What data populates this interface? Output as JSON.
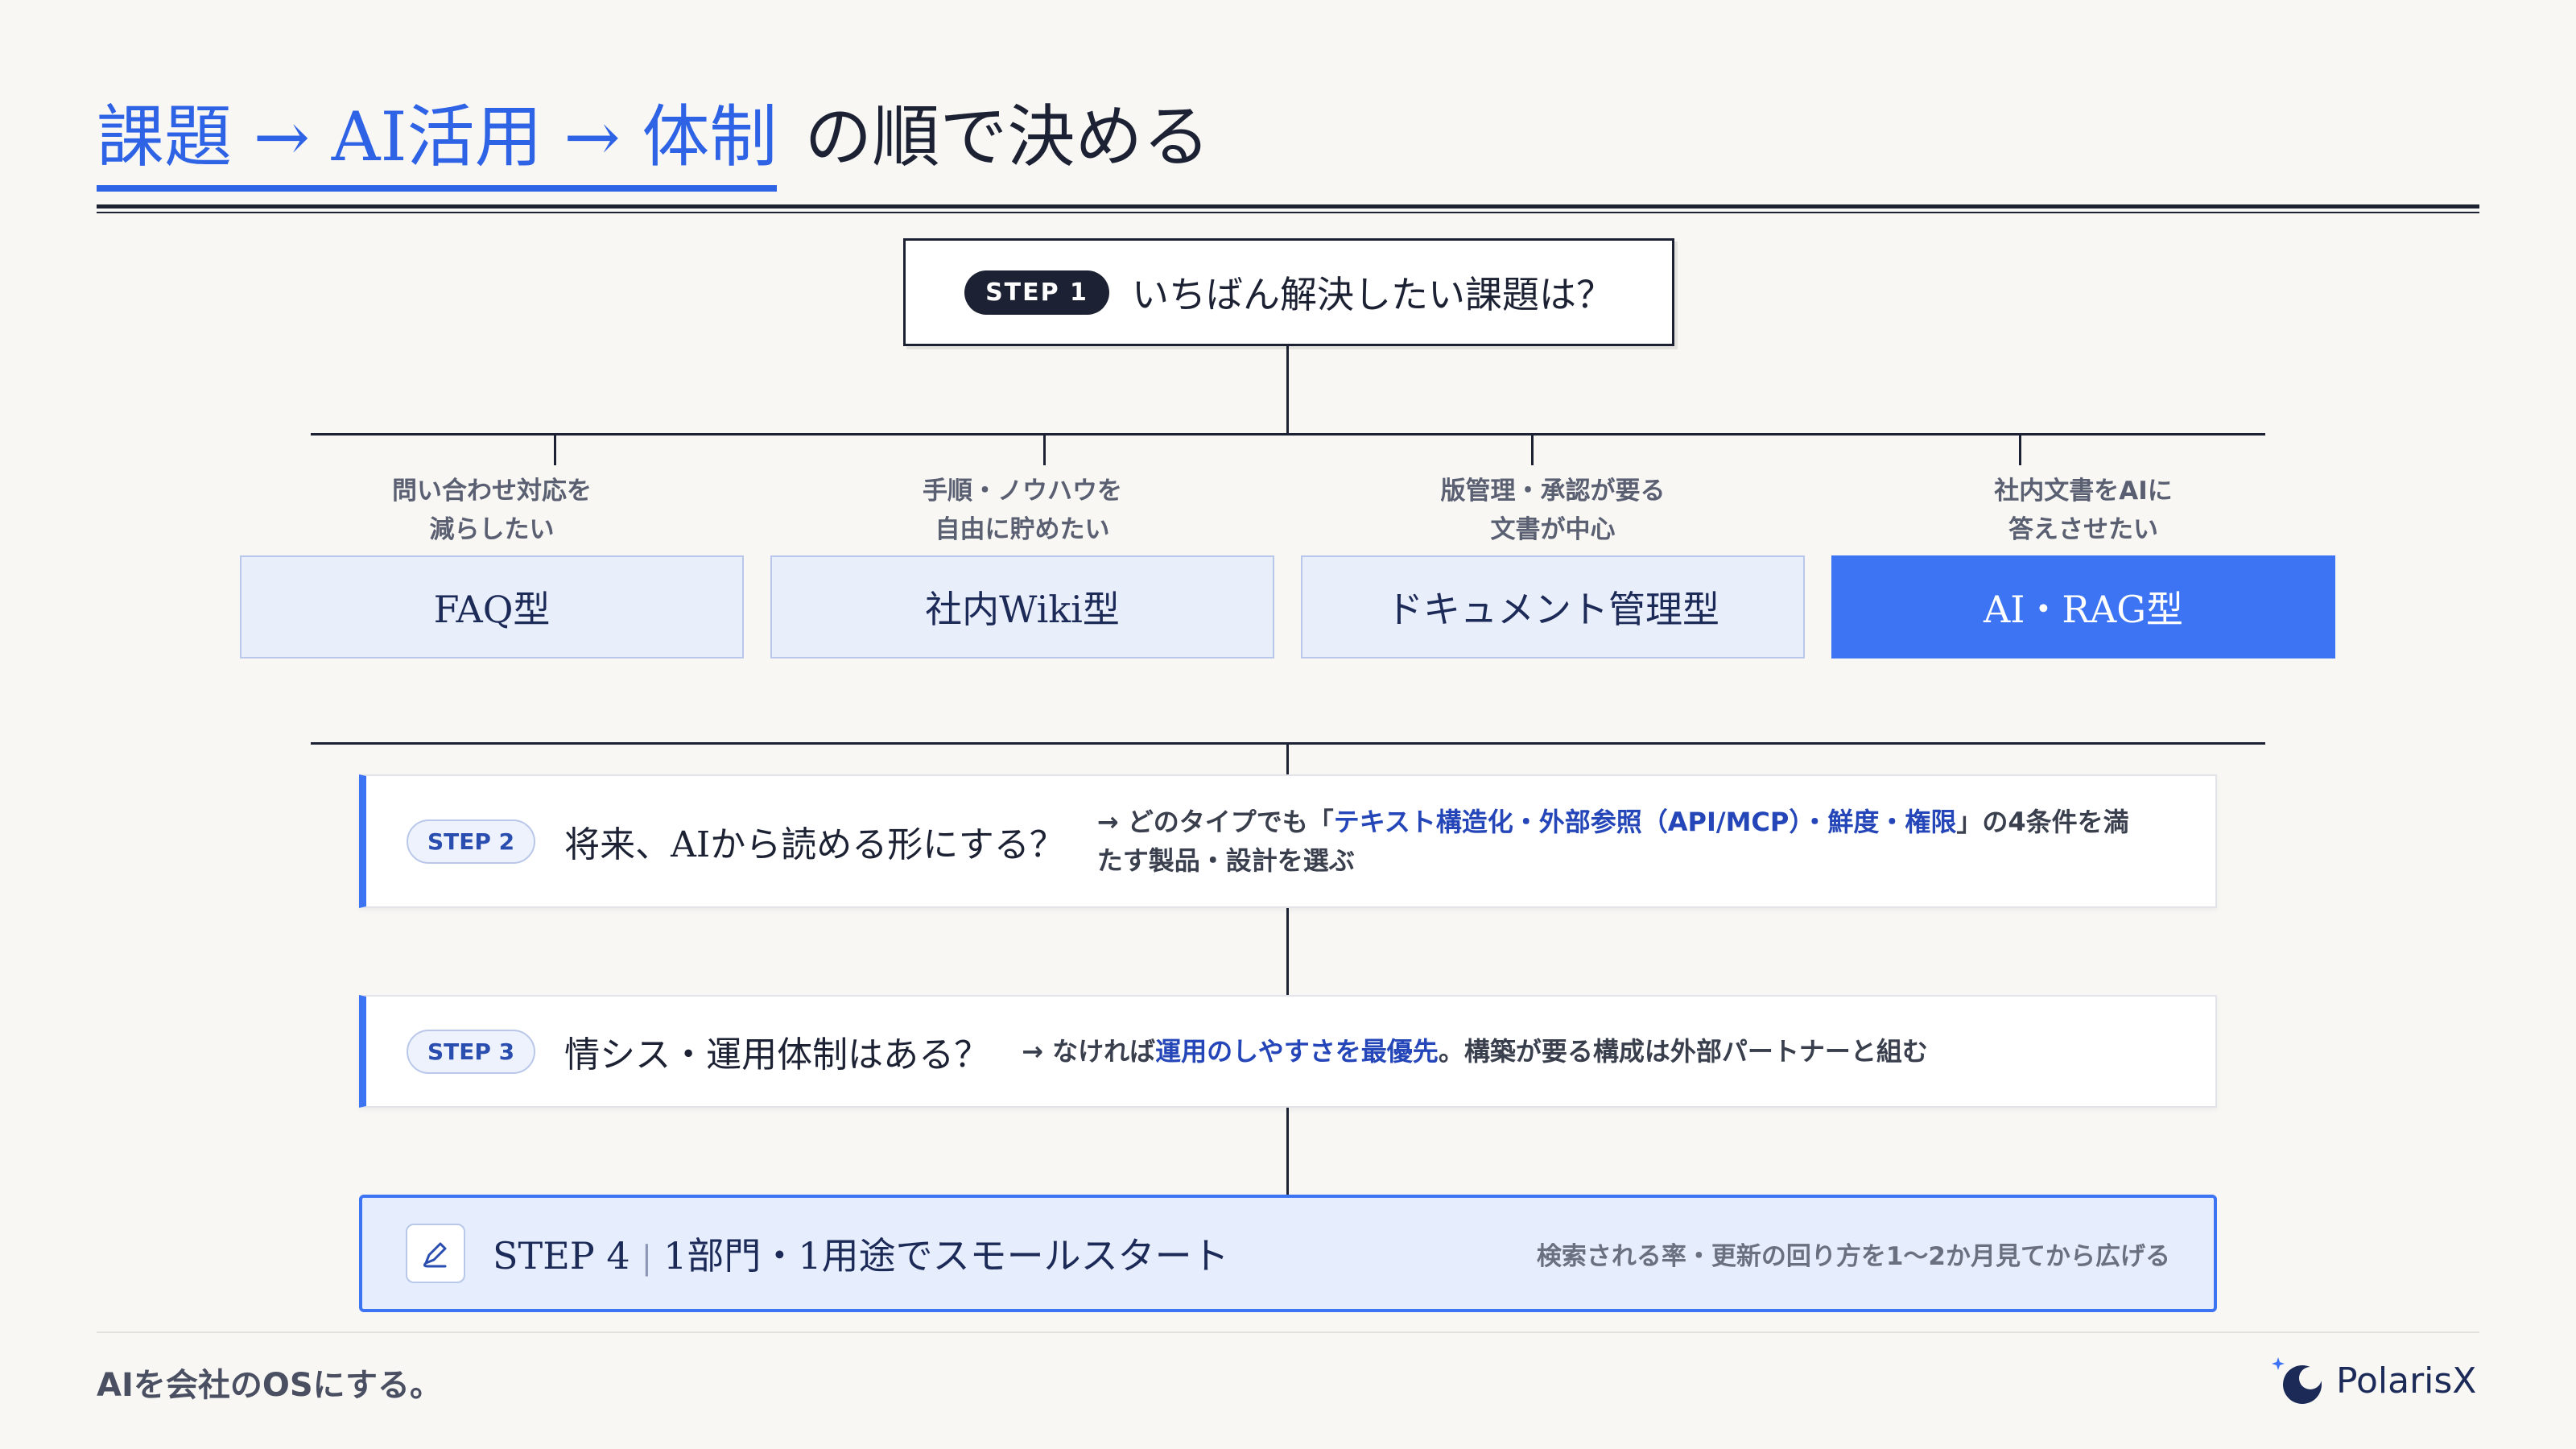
{
  "title": {
    "highlight": "課題 → AI活用 → 体制",
    "rest": "の順で決める"
  },
  "step1": {
    "badge": "STEP 1",
    "question": "いちばん解決したい課題は？"
  },
  "categories": [
    {
      "desc_line1": "問い合わせ対応を",
      "desc_line2": "減らしたい",
      "label": "FAQ型",
      "active": false
    },
    {
      "desc_line1": "手順・ノウハウを",
      "desc_line2": "自由に貯めたい",
      "label": "社内Wiki型",
      "active": false
    },
    {
      "desc_line1": "版管理・承認が要る",
      "desc_line2": "文書が中心",
      "label": "ドキュメント管理型",
      "active": false
    },
    {
      "desc_line1": "社内文書をAIに",
      "desc_line2": "答えさせたい",
      "label": "AI・RAG型",
      "active": true
    }
  ],
  "step2": {
    "badge": "STEP 2",
    "question": "将来、AIから読める形にする？",
    "answer_prefix": "→ どのタイプでも「",
    "answer_highlight": "テキスト構造化・外部参照（API/MCP）・鮮度・権限",
    "answer_suffix_line1": "」の4条件を満",
    "answer_suffix_line2": "たす製品・設計を選ぶ"
  },
  "step3": {
    "badge": "STEP 3",
    "question": "情シス・運用体制はある？",
    "answer_prefix": "→ なければ",
    "answer_highlight": "運用のしやすさを最優先",
    "answer_suffix": "。構築が要る構成は外部パートナーと組む"
  },
  "step4": {
    "label": "STEP 4",
    "separator": "|",
    "text": "1部門・1用途でスモールスタート",
    "note": "検索される率・更新の回り方を1〜2か月見てから広げる",
    "icon": "pen-icon"
  },
  "footer": {
    "tagline": "AIを会社のOSにする。",
    "brand": "PolarisX"
  },
  "colors": {
    "accent": "#3d74f4",
    "title_blue": "#2f63e6",
    "dark": "#1c2233",
    "light_box": "#e9eefb"
  }
}
